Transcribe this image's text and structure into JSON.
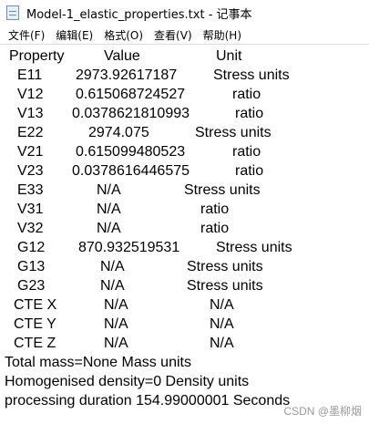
{
  "window": {
    "title": "Model-1_elastic_properties.txt - 记事本"
  },
  "icons": {
    "app": "notepad-icon"
  },
  "menu": [
    {
      "label": "文件(F)"
    },
    {
      "label": "编辑(E)"
    },
    {
      "label": "格式(O)"
    },
    {
      "label": "查看(V)"
    },
    {
      "label": "帮助(H)"
    }
  ],
  "table": {
    "headers": {
      "property": "Property",
      "value": "Value",
      "unit": "Unit"
    },
    "rows": [
      {
        "property": "E11",
        "value": "2973.92617187",
        "unit": "Stress units"
      },
      {
        "property": "V12",
        "value": "0.615068724527",
        "unit": "ratio"
      },
      {
        "property": "V13",
        "value": "0.0378621810993",
        "unit": "ratio"
      },
      {
        "property": "E22",
        "value": "2974.075",
        "unit": "Stress units"
      },
      {
        "property": "V21",
        "value": "0.615099480523",
        "unit": "ratio"
      },
      {
        "property": "V23",
        "value": "0.0378616446575",
        "unit": "ratio"
      },
      {
        "property": "E33",
        "value": "N/A",
        "unit": "Stress units"
      },
      {
        "property": "V31",
        "value": "N/A",
        "unit": "ratio"
      },
      {
        "property": "V32",
        "value": "N/A",
        "unit": "ratio"
      },
      {
        "property": "G12",
        "value": "870.932519531",
        "unit": "Stress units"
      },
      {
        "property": "G13",
        "value": "N/A",
        "unit": "Stress units"
      },
      {
        "property": "G23",
        "value": "N/A",
        "unit": "Stress units"
      },
      {
        "property": "CTE X",
        "value": "N/A",
        "unit": "N/A"
      },
      {
        "property": "CTE Y",
        "value": "N/A",
        "unit": "N/A"
      },
      {
        "property": "CTE Z",
        "value": "N/A",
        "unit": "N/A"
      }
    ]
  },
  "footer_lines": [
    "Total mass=None Mass units",
    "Homogenised density=0 Density units",
    "processing duration 154.99000001 Seconds"
  ],
  "watermark": "CSDN @墨柳烟"
}
